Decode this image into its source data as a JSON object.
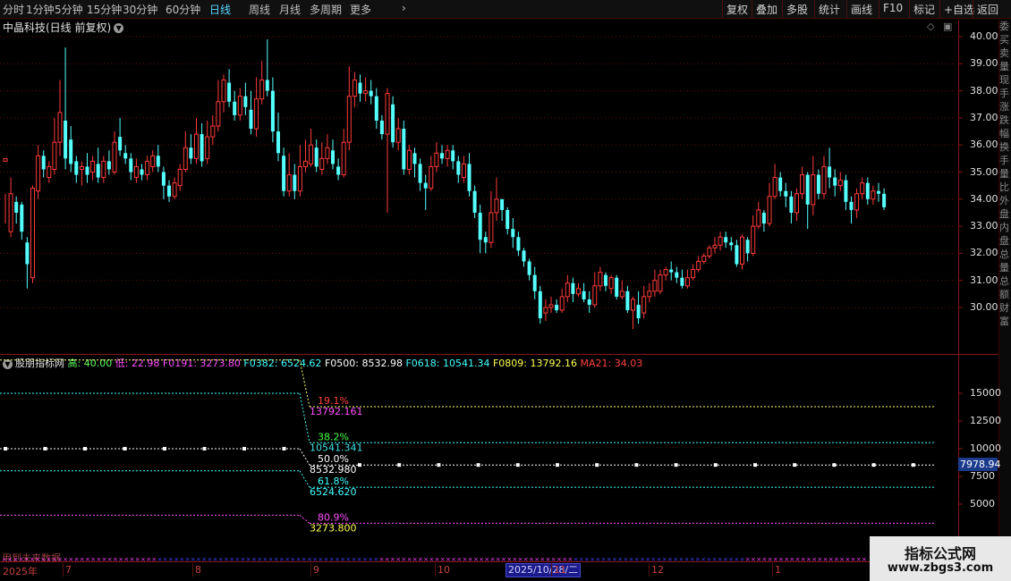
{
  "toolbar": {
    "periods": [
      "分时",
      "1分钟",
      "5分钟",
      "15分钟",
      "30分钟",
      "60分钟",
      "日线",
      "周线",
      "月线",
      "多周期",
      "更多"
    ],
    "active_period": "日线",
    "more_chevron": "›",
    "right_buttons": [
      "复权",
      "叠加",
      "多股",
      "统计",
      "画线",
      "F10",
      "标记",
      "+自选",
      "返回"
    ]
  },
  "main_panel": {
    "stock_title": "中晶科技(日线 前复权)",
    "title_dropdown_icon": "chevron-down-icon",
    "price_labels": [
      "40.00",
      "39.00",
      "38.00",
      "37.00",
      "36.00",
      "35.00",
      "34.00",
      "33.00",
      "32.00",
      "31.00",
      "30.00"
    ]
  },
  "candles": [
    [
      35.4,
      35.5,
      34.2,
      33.1
    ],
    [
      32.8,
      34.2,
      34.8,
      32.6
    ],
    [
      33.9,
      33.5,
      34.1,
      33.1
    ],
    [
      33.8,
      32.8,
      33.9,
      32.5
    ],
    [
      32.4,
      31.6,
      32.6,
      30.7
    ],
    [
      31.1,
      34.4,
      34.5,
      30.9
    ],
    [
      34.3,
      35.6,
      36.0,
      34.0
    ],
    [
      35.6,
      35.1,
      35.8,
      34.8
    ],
    [
      34.8,
      35.2,
      35.4,
      34.6
    ],
    [
      35.1,
      36.1,
      37.0,
      34.9
    ],
    [
      36.1,
      37.2,
      38.4,
      35.6
    ],
    [
      36.9,
      35.5,
      39.6,
      35.1
    ],
    [
      36.2,
      35.3,
      36.7,
      35.0
    ],
    [
      35.4,
      34.9,
      35.6,
      34.6
    ],
    [
      35.1,
      35.2,
      35.4,
      34.5
    ],
    [
      35.2,
      34.9,
      35.7,
      34.6
    ],
    [
      35.0,
      35.4,
      35.6,
      34.7
    ],
    [
      35.3,
      34.8,
      35.9,
      34.6
    ],
    [
      34.8,
      35.4,
      35.6,
      34.6
    ],
    [
      35.4,
      35.1,
      35.8,
      34.9
    ],
    [
      35.0,
      36.1,
      36.5,
      34.9
    ],
    [
      36.3,
      35.8,
      37.0,
      35.6
    ],
    [
      35.7,
      35.5,
      36.0,
      35.3
    ],
    [
      35.5,
      35.0,
      35.7,
      34.7
    ],
    [
      34.8,
      35.2,
      35.5,
      34.6
    ],
    [
      35.1,
      34.9,
      35.3,
      34.7
    ],
    [
      34.9,
      35.4,
      35.6,
      34.7
    ],
    [
      35.2,
      35.6,
      35.8,
      35.0
    ],
    [
      35.6,
      35.2,
      36.0,
      35.0
    ],
    [
      35.0,
      34.5,
      35.2,
      34.0
    ],
    [
      34.5,
      34.1,
      34.7,
      33.9
    ],
    [
      34.1,
      34.6,
      34.8,
      34.0
    ],
    [
      34.5,
      35.1,
      35.3,
      34.3
    ],
    [
      35.1,
      35.9,
      36.5,
      35.0
    ],
    [
      35.9,
      35.5,
      36.4,
      35.3
    ],
    [
      35.5,
      36.4,
      37.0,
      35.3
    ],
    [
      36.4,
      35.4,
      36.8,
      35.2
    ],
    [
      35.5,
      36.3,
      36.9,
      35.3
    ],
    [
      36.3,
      36.7,
      37.1,
      36.0
    ],
    [
      36.7,
      37.6,
      38.4,
      36.5
    ],
    [
      37.6,
      38.4,
      38.6,
      37.2
    ],
    [
      38.3,
      37.6,
      38.8,
      37.4
    ],
    [
      37.6,
      37.1,
      38.0,
      36.9
    ],
    [
      37.1,
      37.8,
      38.1,
      36.9
    ],
    [
      37.8,
      37.4,
      38.3,
      37.1
    ],
    [
      37.3,
      36.6,
      38.0,
      36.4
    ],
    [
      36.6,
      37.7,
      38.5,
      36.3
    ],
    [
      37.7,
      38.4,
      39.1,
      37.5
    ],
    [
      38.4,
      38.0,
      39.9,
      37.8
    ],
    [
      38.0,
      36.5,
      38.5,
      36.1
    ],
    [
      36.5,
      35.7,
      37.2,
      35.4
    ],
    [
      35.6,
      34.3,
      35.9,
      34.1
    ],
    [
      34.3,
      34.9,
      35.7,
      34.1
    ],
    [
      34.9,
      34.3,
      35.3,
      34.0
    ],
    [
      34.3,
      35.2,
      36.0,
      34.1
    ],
    [
      35.2,
      35.4,
      36.2,
      35.0
    ],
    [
      35.3,
      36.0,
      36.6,
      35.2
    ],
    [
      35.9,
      35.2,
      36.2,
      35.0
    ],
    [
      35.1,
      35.5,
      36.1,
      34.9
    ],
    [
      35.5,
      35.9,
      36.4,
      35.3
    ],
    [
      35.8,
      35.3,
      36.2,
      35.1
    ],
    [
      35.2,
      34.9,
      35.5,
      34.7
    ],
    [
      34.9,
      36.1,
      36.6,
      34.8
    ],
    [
      36.1,
      37.8,
      38.9,
      35.8
    ],
    [
      37.8,
      38.4,
      38.7,
      37.4
    ],
    [
      38.3,
      37.9,
      38.6,
      37.6
    ],
    [
      37.9,
      38.0,
      38.5,
      37.6
    ],
    [
      38.0,
      37.8,
      38.4,
      37.5
    ],
    [
      37.8,
      36.9,
      38.1,
      36.6
    ],
    [
      36.9,
      36.4,
      37.1,
      36.2
    ],
    [
      36.4,
      37.9,
      38.1,
      33.5
    ],
    [
      37.5,
      36.1,
      37.8,
      35.9
    ],
    [
      36.1,
      36.6,
      37.0,
      35.8
    ],
    [
      36.6,
      35.1,
      36.9,
      34.9
    ],
    [
      35.1,
      35.8,
      36.0,
      34.9
    ],
    [
      35.7,
      35.3,
      35.9,
      34.8
    ],
    [
      35.3,
      34.6,
      35.5,
      34.3
    ],
    [
      34.6,
      34.4,
      34.9,
      33.6
    ],
    [
      34.4,
      35.2,
      35.6,
      34.3
    ],
    [
      35.2,
      35.7,
      36.1,
      35.0
    ],
    [
      35.7,
      35.5,
      36.0,
      35.3
    ],
    [
      35.5,
      35.8,
      36.0,
      35.2
    ],
    [
      35.8,
      35.4,
      36.0,
      35.1
    ],
    [
      35.4,
      34.9,
      35.6,
      34.6
    ],
    [
      34.8,
      35.3,
      35.6,
      34.6
    ],
    [
      35.3,
      34.3,
      35.7,
      34.1
    ],
    [
      34.3,
      33.5,
      34.5,
      33.3
    ],
    [
      33.5,
      32.5,
      33.8,
      32.0
    ],
    [
      32.6,
      32.4,
      32.8,
      32.0
    ],
    [
      32.4,
      33.5,
      34.3,
      32.2
    ],
    [
      33.5,
      34.0,
      34.8,
      33.2
    ],
    [
      34.0,
      33.6,
      34.0,
      33.2
    ],
    [
      33.6,
      32.9,
      33.7,
      32.7
    ],
    [
      32.9,
      32.6,
      33.3,
      32.2
    ],
    [
      32.6,
      32.1,
      32.8,
      31.9
    ],
    [
      32.1,
      31.7,
      32.2,
      31.5
    ],
    [
      31.7,
      31.2,
      31.8,
      31.0
    ],
    [
      31.2,
      30.6,
      31.5,
      30.3
    ],
    [
      30.6,
      29.6,
      30.8,
      29.4
    ],
    [
      29.8,
      30.0,
      30.3,
      29.5
    ],
    [
      30.0,
      30.1,
      30.4,
      29.8
    ],
    [
      30.1,
      29.9,
      30.3,
      29.8
    ],
    [
      29.9,
      30.4,
      30.7,
      29.8
    ],
    [
      30.4,
      30.9,
      31.2,
      30.2
    ],
    [
      30.9,
      30.5,
      31.1,
      30.2
    ],
    [
      30.5,
      30.7,
      30.9,
      30.4
    ],
    [
      30.6,
      30.3,
      30.9,
      30.2
    ],
    [
      30.3,
      30.1,
      30.6,
      29.8
    ],
    [
      30.1,
      30.8,
      31.3,
      30.0
    ],
    [
      30.8,
      31.3,
      31.5,
      30.6
    ],
    [
      31.2,
      30.8,
      31.3,
      30.6
    ],
    [
      30.7,
      31.1,
      31.2,
      30.5
    ],
    [
      31.1,
      30.4,
      31.2,
      30.3
    ],
    [
      30.4,
      30.6,
      31.0,
      30.3
    ],
    [
      30.6,
      29.9,
      30.8,
      29.8
    ],
    [
      29.9,
      30.3,
      30.4,
      29.2
    ],
    [
      30.1,
      29.6,
      30.6,
      29.4
    ],
    [
      29.8,
      30.4,
      30.8,
      29.6
    ],
    [
      30.4,
      30.6,
      30.9,
      30.2
    ],
    [
      30.6,
      31.0,
      31.4,
      30.4
    ],
    [
      30.6,
      31.2,
      31.4,
      30.5
    ],
    [
      31.2,
      31.4,
      31.5,
      31.0
    ],
    [
      31.4,
      31.3,
      31.7,
      31.0
    ],
    [
      31.3,
      31.1,
      31.5,
      30.9
    ],
    [
      31.1,
      30.8,
      31.4,
      30.7
    ],
    [
      30.8,
      31.1,
      31.4,
      30.7
    ],
    [
      31.1,
      31.4,
      31.6,
      31.0
    ],
    [
      31.4,
      31.7,
      31.9,
      31.3
    ],
    [
      31.7,
      31.9,
      32.0,
      31.6
    ],
    [
      31.9,
      32.2,
      32.3,
      31.8
    ],
    [
      32.2,
      32.3,
      32.6,
      32.0
    ],
    [
      32.3,
      32.6,
      32.8,
      32.1
    ],
    [
      32.6,
      32.4,
      32.8,
      32.2
    ],
    [
      32.4,
      32.3,
      32.6,
      32.1
    ],
    [
      32.3,
      31.6,
      32.5,
      31.5
    ],
    [
      31.6,
      32.6,
      32.7,
      31.4
    ],
    [
      32.5,
      32.0,
      32.6,
      31.7
    ],
    [
      32.0,
      33.0,
      33.4,
      31.9
    ],
    [
      33.0,
      33.6,
      33.9,
      32.9
    ],
    [
      33.5,
      33.1,
      33.6,
      32.8
    ],
    [
      33.1,
      34.1,
      34.6,
      33.0
    ],
    [
      34.1,
      34.8,
      35.3,
      34.0
    ],
    [
      34.8,
      34.3,
      35.0,
      34.1
    ],
    [
      34.3,
      34.1,
      34.6,
      33.7
    ],
    [
      34.1,
      33.5,
      34.3,
      33.1
    ],
    [
      33.5,
      34.2,
      34.4,
      33.2
    ],
    [
      34.2,
      34.9,
      35.2,
      34.0
    ],
    [
      34.9,
      33.8,
      35.0,
      32.9
    ],
    [
      33.8,
      34.9,
      35.6,
      33.4
    ],
    [
      34.9,
      34.2,
      35.1,
      34.0
    ],
    [
      34.2,
      35.2,
      35.6,
      34.0
    ],
    [
      35.2,
      34.8,
      35.9,
      34.4
    ],
    [
      34.8,
      34.5,
      35.1,
      34.1
    ],
    [
      34.5,
      34.7,
      35.0,
      34.3
    ],
    [
      34.7,
      33.9,
      34.9,
      33.6
    ],
    [
      33.9,
      33.6,
      34.1,
      33.1
    ],
    [
      33.6,
      34.2,
      34.4,
      33.3
    ],
    [
      34.2,
      34.6,
      34.8,
      34.0
    ],
    [
      34.6,
      34.0,
      34.8,
      33.8
    ],
    [
      34.0,
      34.3,
      34.5,
      33.8
    ],
    [
      34.3,
      34.2,
      34.6,
      33.9
    ],
    [
      34.2,
      33.7,
      34.4,
      33.6
    ]
  ],
  "indicator": {
    "name": "股朋指标网",
    "high_label": "高: 40.00",
    "low_label": "低: 22.98",
    "f0191": "F0191: 3273.80",
    "f0382": "F0382: 6524.62",
    "f0500": "F0500: 8532.98",
    "f0618": "F0618: 10541.34",
    "f0809": "F0809: 13792.16",
    "ma21": "MA21: 34.03",
    "axis_labels": [
      "15000",
      "12500",
      "10000",
      "7500",
      "5000"
    ],
    "current_value": "7978.94",
    "levels": [
      {
        "pct": "19.1%",
        "value": "13792.161",
        "before": 18000,
        "after": 13792,
        "pct_color": "#ff4040",
        "val_color": "#ff50ff",
        "line_color": "#ffff70"
      },
      {
        "pct": "38.2%",
        "value": "10541.341",
        "before": 15000,
        "after": 10541,
        "pct_color": "#40ff40",
        "val_color": "#40e0e0",
        "line_color": "#40ffff"
      },
      {
        "pct": "50.0%",
        "value": "8532.980",
        "before": 10000,
        "after": 8533,
        "pct_color": "#ffffff",
        "val_color": "#ffffff",
        "line_color": "#ffffff"
      },
      {
        "pct": "61.8%",
        "value": "6524.620",
        "before": 8000,
        "after": 6525,
        "pct_color": "#40ffff",
        "val_color": "#40ffff",
        "line_color": "#40ffff"
      },
      {
        "pct": "80.9%",
        "value": "3273.800",
        "before": 4000,
        "after": 3274,
        "pct_color": "#ff50ff",
        "val_color": "#ffff50",
        "line_color": "#ff50ff"
      }
    ],
    "future_note": "用到未来数据"
  },
  "time_axis": {
    "year_label": "2025年",
    "months": [
      "7",
      "8",
      "9",
      "10",
      "11",
      "12",
      "1"
    ],
    "cursor_date": "2025/10/28/二"
  },
  "side_strip": {
    "text": "委买卖量现手涨跌幅换手量比外盘内盘总量总额财富"
  },
  "watermark": {
    "title": "指标公式网",
    "url": "www.zbgs3.com"
  },
  "colors": {
    "up": "#ff3a3a",
    "down": "#54ffff",
    "grid": "#7a1010",
    "active": "#5ad6ff"
  }
}
